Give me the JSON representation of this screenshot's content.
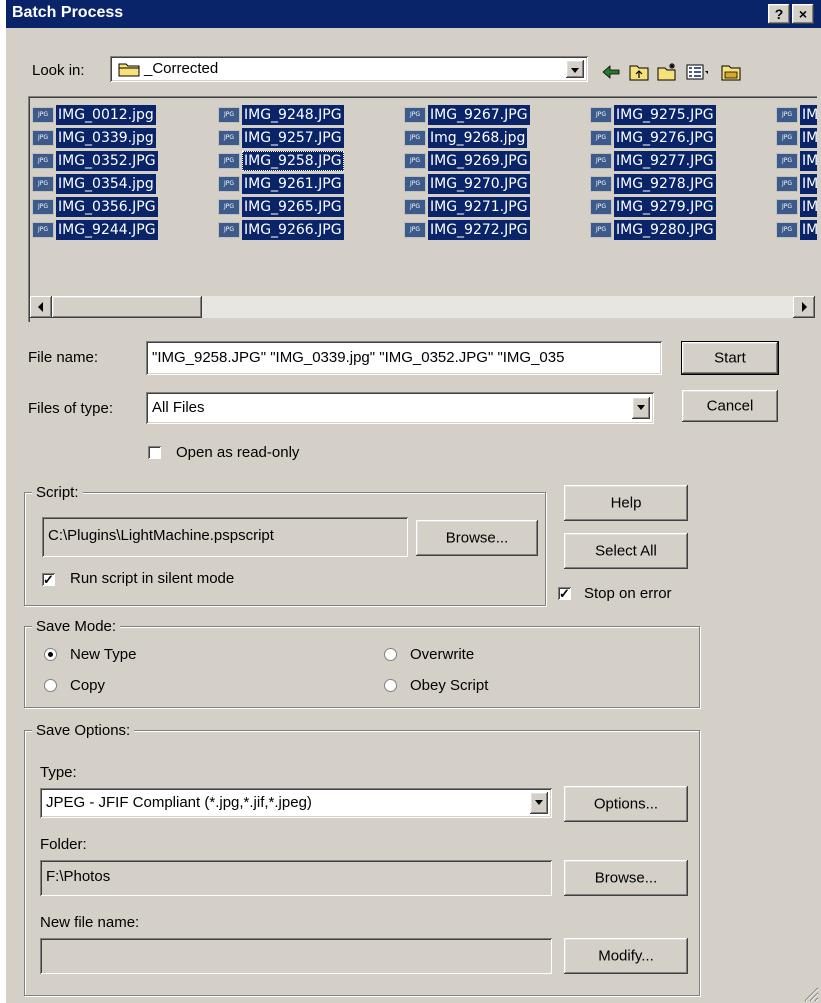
{
  "window": {
    "title": "Batch Process",
    "help_button": "?",
    "close_button": "×"
  },
  "look_in": {
    "label": "Look in:",
    "value": "_Corrected"
  },
  "files": [
    [
      "IMG_0012.jpg",
      "IMG_0339.jpg",
      "IMG_0352.JPG",
      "IMG_0354.jpg",
      "IMG_0356.JPG",
      "IMG_9244.JPG"
    ],
    [
      "IMG_9248.JPG",
      "IMG_9257.JPG",
      "IMG_9258.JPG",
      "IMG_9261.JPG",
      "IMG_9265.JPG",
      "IMG_9266.JPG"
    ],
    [
      "IMG_9267.JPG",
      "Img_9268.jpg",
      "IMG_9269.JPG",
      "IMG_9270.JPG",
      "IMG_9271.JPG",
      "IMG_9272.JPG"
    ],
    [
      "IMG_9275.JPG",
      "IMG_9276.JPG",
      "IMG_9277.JPG",
      "IMG_9278.JPG",
      "IMG_9279.JPG",
      "IMG_9280.JPG"
    ],
    [
      "IM",
      "IM",
      "IM",
      "IM",
      "IM",
      "IM"
    ]
  ],
  "file_icon_text": "JPG",
  "file_name": {
    "label": "File name:",
    "value": "\"IMG_9258.JPG\" \"IMG_0339.jpg\" \"IMG_0352.JPG\" \"IMG_035"
  },
  "files_of_type": {
    "label": "Files of type:",
    "value": "All Files"
  },
  "open_readonly": {
    "label": "Open as read-only",
    "checked": false
  },
  "buttons": {
    "start": "Start",
    "cancel": "Cancel",
    "help": "Help",
    "select_all": "Select All",
    "browse_script": "Browse...",
    "options": "Options...",
    "browse_folder": "Browse...",
    "modify": "Modify..."
  },
  "stop_on_error": {
    "label": "Stop on error",
    "checked": true
  },
  "script": {
    "group_label": "Script:",
    "path": "C:\\Plugins\\LightMachine.pspscript",
    "silent_label": "Run script in silent mode",
    "silent_checked": true
  },
  "save_mode": {
    "group_label": "Save Mode:",
    "options": [
      "New Type",
      "Copy",
      "Overwrite",
      "Obey Script"
    ],
    "selected": "New Type"
  },
  "save_options": {
    "group_label": "Save Options:",
    "type_label": "Type:",
    "type_value": "JPEG - JFIF Compliant (*.jpg,*.jif,*.jpeg)",
    "folder_label": "Folder:",
    "folder_value": "F:\\Photos",
    "new_file_name_label": "New file name:",
    "new_file_name_value": ""
  }
}
